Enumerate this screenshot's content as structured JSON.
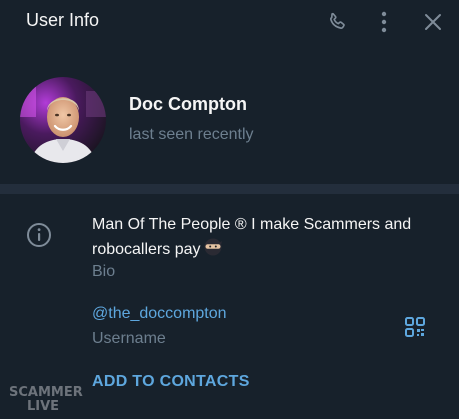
{
  "header": {
    "title": "User Info",
    "icons": [
      "phone-icon",
      "more-vertical-icon",
      "close-icon"
    ]
  },
  "profile": {
    "name": "Doc Compton",
    "status": "last seen recently"
  },
  "info": {
    "bio": "Man Of The People ® I make Scammers and robocallers pay",
    "bio_emoji": "ninja-emoji",
    "bio_label": "Bio",
    "username": "@the_doccompton",
    "username_label": "Username",
    "add_contacts": "ADD TO CONTACTS"
  },
  "watermark": {
    "line1": "SCAMMER",
    "line2": "LIVE"
  },
  "colors": {
    "background": "#17212b",
    "divider": "#232e3c",
    "accent": "#5ea7de",
    "muted": "#6d7f8f",
    "text": "#f5f5f5"
  }
}
